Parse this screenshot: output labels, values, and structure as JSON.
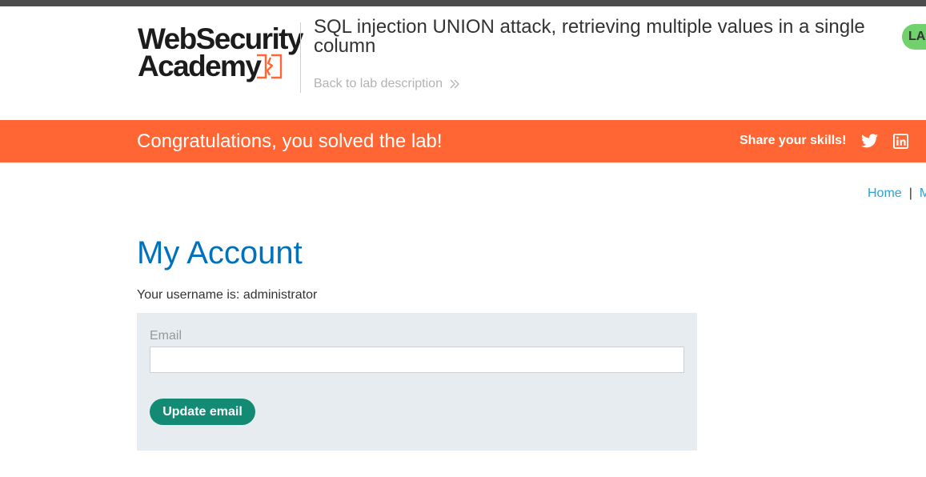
{
  "header": {
    "logo": {
      "line1": "WebSecurity",
      "line2": "Academy"
    },
    "lab_title": "SQL injection UNION attack, retrieving multiple values in a single column",
    "back_link": "Back to lab description",
    "lab_status": "LAB Solved",
    "lab_status_visible": "LA"
  },
  "banner": {
    "message": "Congratulations, you solved the lab!",
    "share_label": "Share your skills!",
    "icons": [
      "twitter-icon",
      "linkedin-icon"
    ]
  },
  "nav": {
    "home": "Home",
    "separator": "|",
    "my_account": "M"
  },
  "main": {
    "title": "My Account",
    "username_line": "Your username is: administrator",
    "form": {
      "email_label": "Email",
      "email_value": "",
      "email_placeholder": "",
      "button_label": "Update email"
    }
  },
  "colors": {
    "top_bar": "#4c4c4d",
    "banner": "#ff6633",
    "title_blue": "#0071bc",
    "link_blue": "#29a3d8",
    "button_green": "#138a74",
    "status_green": "#70d16d",
    "panel_bg": "#e6ecef"
  }
}
